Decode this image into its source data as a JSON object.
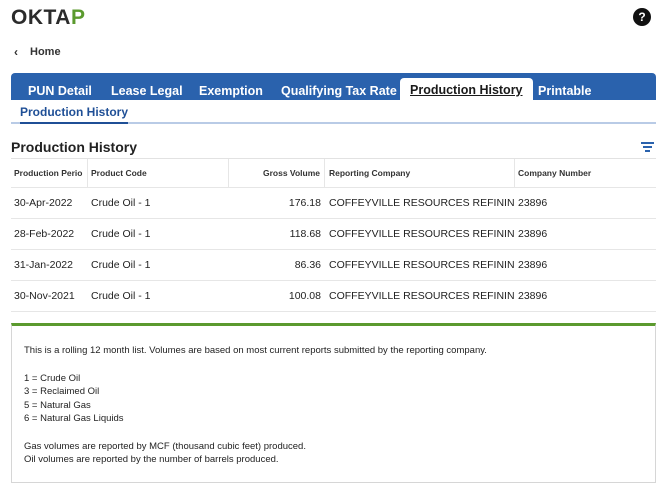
{
  "app": {
    "logo_part1": "OKTA",
    "logo_part2": "P",
    "help_glyph": "?"
  },
  "nav": {
    "back_label": "Home"
  },
  "tabs": [
    {
      "label": "PUN Detail"
    },
    {
      "label": "Lease Legal"
    },
    {
      "label": "Exemption"
    },
    {
      "label": "Qualifying Tax Rate"
    },
    {
      "label": "Production History"
    },
    {
      "label": "Printable"
    }
  ],
  "subtab": {
    "label": "Production History"
  },
  "section": {
    "title": "Production History"
  },
  "table": {
    "columns": [
      "Production Perio",
      "Product Code",
      "Gross Volume",
      "Reporting Company",
      "Company Number"
    ],
    "rows": [
      [
        "30-Apr-2022",
        "Crude Oil - 1",
        "176.18",
        "COFFEYVILLE RESOURCES REFINING & M",
        "23896"
      ],
      [
        "28-Feb-2022",
        "Crude Oil - 1",
        "118.68",
        "COFFEYVILLE RESOURCES REFINING & M",
        "23896"
      ],
      [
        "31-Jan-2022",
        "Crude Oil - 1",
        "86.36",
        "COFFEYVILLE RESOURCES REFINING & M",
        "23896"
      ],
      [
        "30-Nov-2021",
        "Crude Oil - 1",
        "100.08",
        "COFFEYVILLE RESOURCES REFINING & M",
        "23896"
      ]
    ]
  },
  "info": {
    "intro": "This is a rolling 12 month list. Volumes are based on most current reports submitted by the reporting company.",
    "codes": [
      "1 = Crude Oil",
      "3 = Reclaimed Oil",
      "5 = Natural Gas",
      "6 = Natural Gas Liquids"
    ],
    "gas_note": "Gas volumes are reported by MCF (thousand cubic feet) produced.",
    "oil_note": "Oil volumes are reported by the number of barrels produced."
  },
  "colors": {
    "brand_green": "#5b9a2e",
    "tab_blue": "#2a62ad",
    "link_blue": "#1f4f96"
  }
}
